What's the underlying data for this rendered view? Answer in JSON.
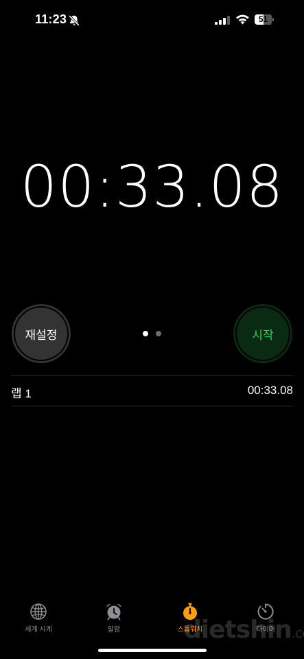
{
  "status_bar": {
    "time": "11:23",
    "battery_level": "51",
    "battery_fraction": 0.51,
    "icons": [
      "bell-slash-icon",
      "cellular-signal-icon",
      "wifi-icon",
      "battery-icon"
    ]
  },
  "stopwatch": {
    "display": "00:33.08"
  },
  "controls": {
    "reset_label": "재설정",
    "start_label": "시작",
    "page_count": 2,
    "active_page": 1
  },
  "laps": [
    {
      "label": "랩 1",
      "time": "00:33.08"
    }
  ],
  "tab_bar": {
    "items": [
      {
        "label": "세계 시계",
        "icon": "globe-icon",
        "active": false
      },
      {
        "label": "알람",
        "icon": "alarm-clock-icon",
        "active": false
      },
      {
        "label": "스톱워치",
        "icon": "stopwatch-icon",
        "active": true
      },
      {
        "label": "타이머",
        "icon": "timer-icon",
        "active": false
      }
    ]
  },
  "colors": {
    "background": "#000000",
    "accent": "#ff9f0a",
    "start_text": "#30d158",
    "start_bg": "#0a2a13",
    "reset_bg": "#333333",
    "inactive_tab": "#8e8e93"
  },
  "watermark": {
    "text": "dietshin",
    "suffix": ".com"
  }
}
